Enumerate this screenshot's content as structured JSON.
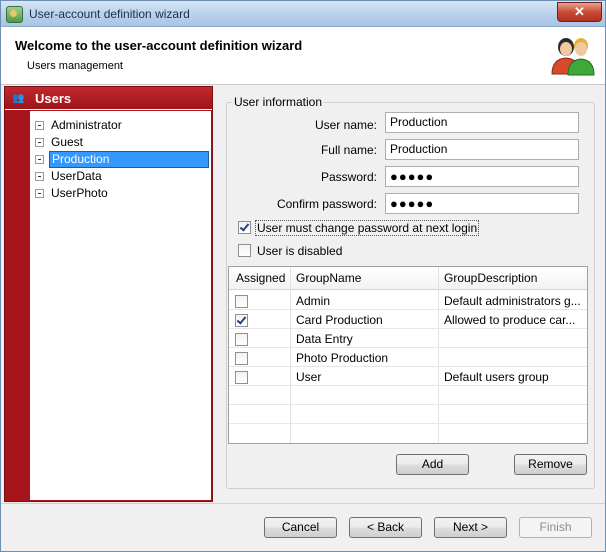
{
  "window": {
    "title": "User-account definition wizard",
    "close_label": "✕"
  },
  "header": {
    "title": "Welcome to the user-account definition wizard",
    "subtitle": "Users management"
  },
  "left_panel": {
    "title": "Users",
    "users": [
      "Administrator",
      "Guest",
      "Production",
      "UserData",
      "UserPhoto"
    ],
    "selected": "Production"
  },
  "user_info": {
    "group_title": "User information",
    "username_label": "User name:",
    "username_value": "Production",
    "fullname_label": "Full name:",
    "fullname_value": "Production",
    "password_label": "Password:",
    "password_value": "●●●●●",
    "confirm_label": "Confirm password:",
    "confirm_value": "●●●●●",
    "must_change_label": "User must change password at next login",
    "must_change_checked": true,
    "disabled_label": "User is disabled",
    "disabled_checked": false
  },
  "groups": {
    "headers": [
      "Assigned",
      "GroupName",
      "GroupDescription"
    ],
    "rows": [
      {
        "assigned": false,
        "name": "Admin",
        "description": "Default administrators g..."
      },
      {
        "assigned": true,
        "name": "Card Production",
        "description": "Allowed to produce car..."
      },
      {
        "assigned": false,
        "name": "Data Entry",
        "description": ""
      },
      {
        "assigned": false,
        "name": "Photo Production",
        "description": ""
      },
      {
        "assigned": false,
        "name": "User",
        "description": "Default users group"
      }
    ]
  },
  "buttons": {
    "add": "Add",
    "remove": "Remove",
    "cancel": "Cancel",
    "back": "< Back",
    "next": "Next >",
    "finish": "Finish"
  }
}
